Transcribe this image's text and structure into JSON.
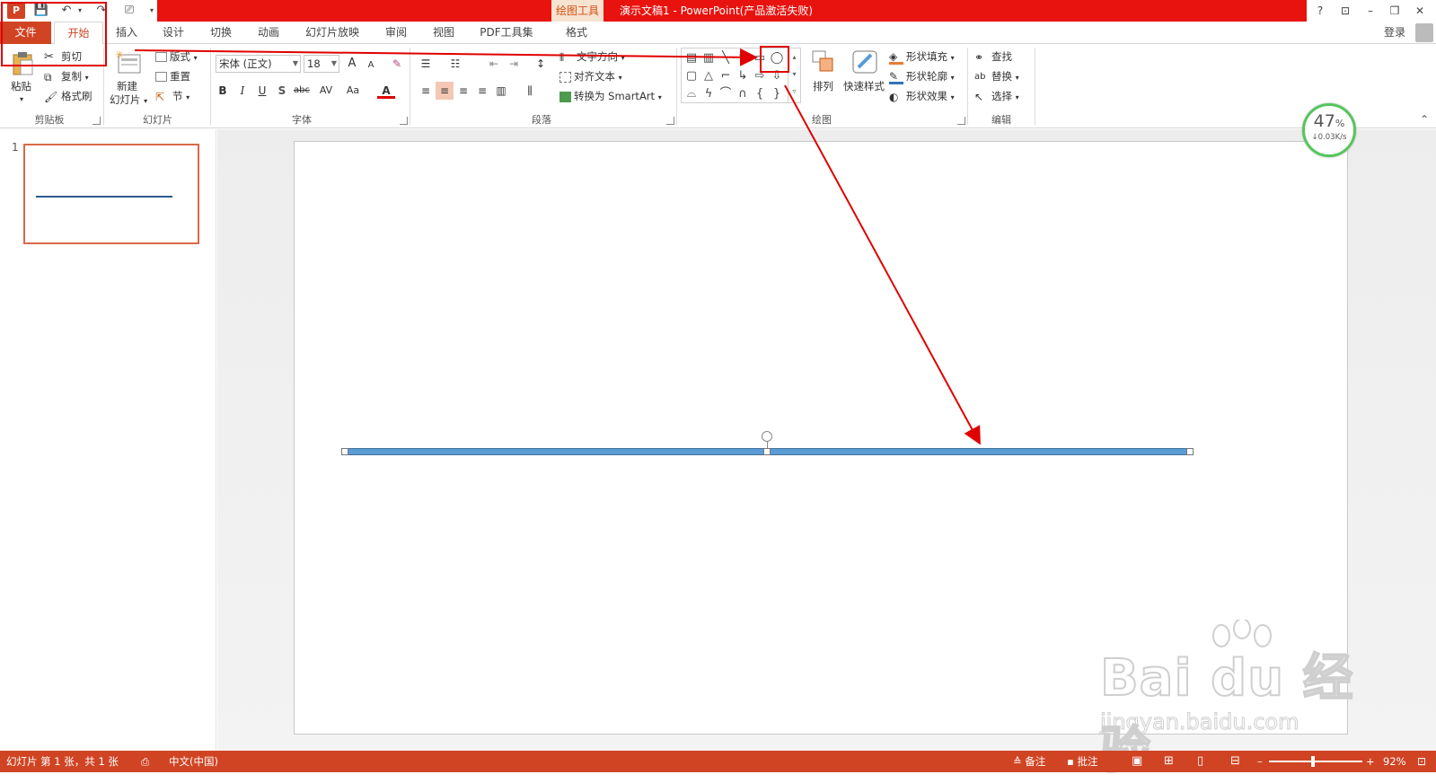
{
  "titlebar": {
    "contextual_tab": "绘图工具",
    "window_title": "演示文稿1 -  PowerPoint(产品激活失败)",
    "logo_letter": "P",
    "help": "?",
    "ribbon_display": "⊡",
    "minimize": "–",
    "restore": "❐",
    "close": "✕"
  },
  "tabs": {
    "file": "文件",
    "home": "开始",
    "insert": "插入",
    "design": "设计",
    "transitions": "切换",
    "animations": "动画",
    "slideshow": "幻灯片放映",
    "review": "审阅",
    "view": "视图",
    "pdf": "PDF工具集",
    "format": "格式",
    "login": "登录"
  },
  "clipboard": {
    "paste": "粘贴",
    "cut": "剪切",
    "copy": "复制",
    "format_painter": "格式刷",
    "label": "剪贴板"
  },
  "slides_group": {
    "new_slide_line1": "新建",
    "new_slide_line2": "幻灯片",
    "layout": "版式",
    "reset": "重置",
    "section": "节",
    "label": "幻灯片"
  },
  "font": {
    "name": "宋体 (正文)",
    "size": "18",
    "bold": "B",
    "italic": "I",
    "underline": "U",
    "shadow": "S",
    "strike": "abc",
    "spacing": "AV",
    "case": "Aa",
    "color": "A",
    "grow": "A",
    "shrink": "A",
    "label": "字体"
  },
  "paragraph": {
    "text_direction": "文字方向",
    "align_text": "对齐文本",
    "convert_smartart": "转换为 SmartArt",
    "label": "段落"
  },
  "drawing": {
    "arrange": "排列",
    "quick_styles": "快速样式",
    "shape_fill": "形状填充",
    "shape_outline": "形状轮廓",
    "shape_effects": "形状效果",
    "label": "绘图"
  },
  "editing": {
    "find": "查找",
    "replace": "替换",
    "select": "选择",
    "label": "编辑"
  },
  "thumbnails": {
    "slide_number": "1"
  },
  "speed_widget": {
    "percent": "47",
    "percent_sign": "%",
    "rate": "↓0.03K/s"
  },
  "statusbar": {
    "slide_info": "幻灯片 第 1 张，共 1 张",
    "language": "中文(中国)",
    "notes": "备注",
    "comments": "批注",
    "zoom_minus": "–",
    "zoom_plus": "+",
    "zoom": "92%"
  },
  "watermark": {
    "logo": "Bai du 经验",
    "url": "jingyan.baidu.com"
  },
  "colors": {
    "titlebar": "#e8130f",
    "accent": "#d04424",
    "line_fill": "#5b9bd5",
    "annotation": "#e00000"
  }
}
